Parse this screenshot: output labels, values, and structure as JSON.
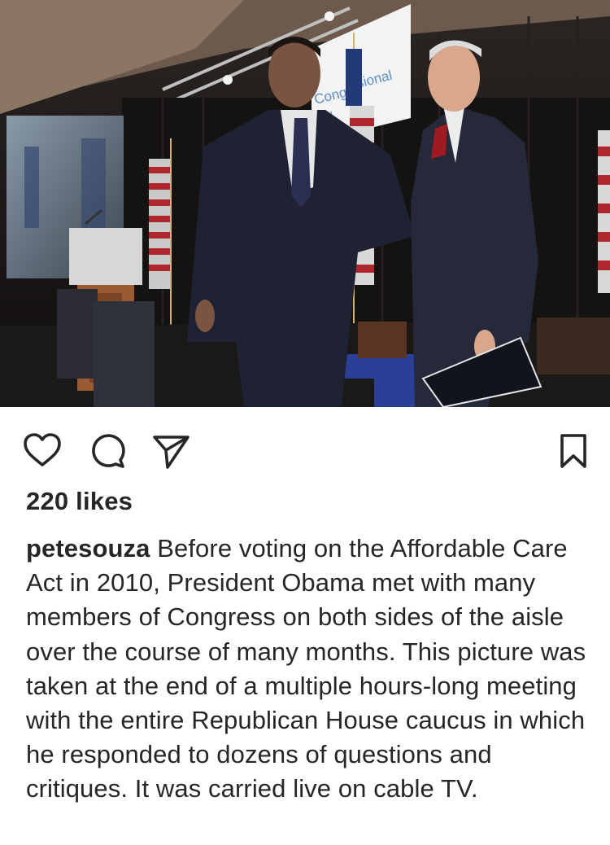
{
  "post": {
    "image": {
      "banner_fragments": [
        "Congr",
        "sional",
        "itu"
      ]
    },
    "actions": {
      "like_icon": "heart-outline-icon",
      "comment_icon": "speech-bubble-icon",
      "share_icon": "paper-plane-icon",
      "save_icon": "bookmark-outline-icon"
    },
    "likes": "220 likes",
    "caption": {
      "username": "petesouza",
      "text": "Before voting on the Affordable Care Act in 2010, President Obama met with many members of Congress on both sides of the aisle over the course of many months. This picture was taken at the end of a multiple hours-long meeting with the entire Republican House caucus in which he responded to dozens of questions and critiques. It was carried live on cable TV."
    }
  }
}
